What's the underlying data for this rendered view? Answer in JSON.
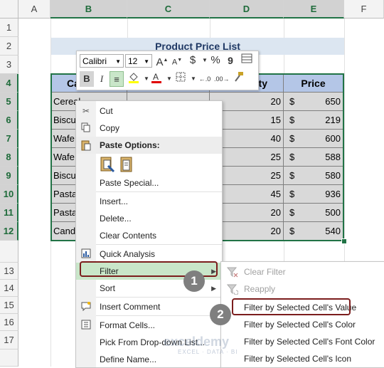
{
  "columns": [
    "A",
    "B",
    "C",
    "D",
    "E",
    "F"
  ],
  "rows": [
    "1",
    "2",
    "3",
    "4",
    "5",
    "6",
    "7",
    "8",
    "9",
    "10",
    "11",
    "12",
    "13",
    "14",
    "15",
    "16",
    "17"
  ],
  "title": "Product Price List",
  "table_headers": {
    "product": "Ca",
    "qty": "ity",
    "price": "Price"
  },
  "table_rows": [
    {
      "product": "Cereal",
      "qty": "20",
      "cur": "$",
      "price": "650"
    },
    {
      "product": "Biscu",
      "qty": "15",
      "cur": "$",
      "price": "219"
    },
    {
      "product": "Wafe",
      "qty": "40",
      "cur": "$",
      "price": "600"
    },
    {
      "product": "Wafe",
      "qty": "25",
      "cur": "$",
      "price": "588"
    },
    {
      "product": "Biscu",
      "qty": "25",
      "cur": "$",
      "price": "580"
    },
    {
      "product": "Pasta",
      "qty": "45",
      "cur": "$",
      "price": "936"
    },
    {
      "product": "Pasta",
      "qty": "20",
      "cur": "$",
      "price": "500"
    },
    {
      "product": "Cand",
      "qty": "20",
      "cur": "$",
      "price": "540"
    }
  ],
  "mini_toolbar": {
    "font": "Calibri",
    "size": "12",
    "bold": "B",
    "italic": "I",
    "percent": "%",
    "comma": "9",
    "dollar": "$",
    "grow": "A",
    "shrink": "A"
  },
  "context_menu": {
    "cut": "Cut",
    "copy": "Copy",
    "paste_options": "Paste Options:",
    "paste_special": "Paste Special...",
    "insert": "Insert...",
    "delete": "Delete...",
    "clear_contents": "Clear Contents",
    "quick_analysis": "Quick Analysis",
    "filter": "Filter",
    "sort": "Sort",
    "insert_comment": "Insert Comment",
    "format_cells": "Format Cells...",
    "pick_list": "Pick From Drop-down List...",
    "define_name": "Define Name..."
  },
  "filter_submenu": {
    "clear_filter": "Clear Filter",
    "reapply": "Reapply",
    "by_value": "Filter by Selected Cell's Value",
    "by_color": "Filter by Selected Cell's Color",
    "by_font_color": "Filter by Selected Cell's Font Color",
    "by_icon": "Filter by Selected Cell's Icon"
  },
  "badges": {
    "one": "1",
    "two": "2"
  },
  "watermark": {
    "name": "exceldemy",
    "tagline": "EXCEL · DATA · BI"
  },
  "colors": {
    "selection": "#217346",
    "header_fill": "#b4c6e7",
    "title_fill": "#dce6f1",
    "highlight": "#c9e6c9",
    "callout": "#7b1d1d"
  }
}
